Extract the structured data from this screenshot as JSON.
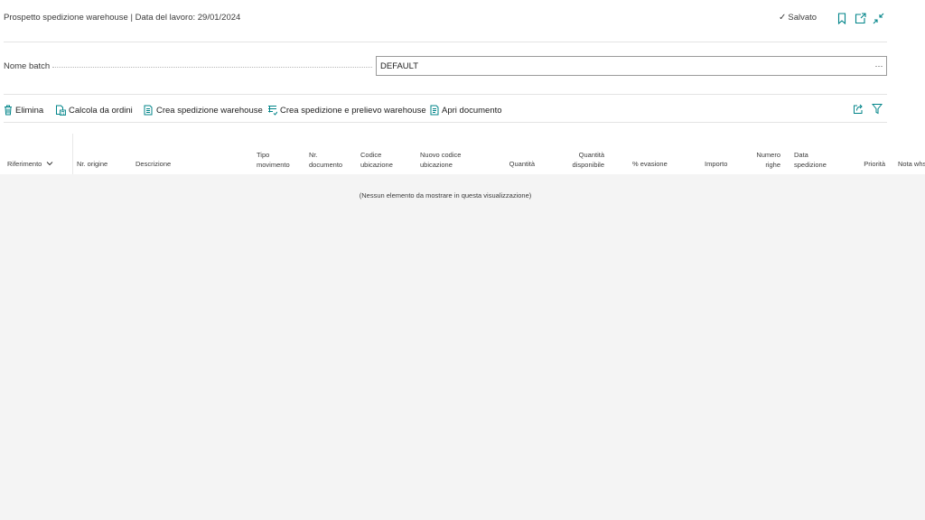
{
  "header": {
    "title": "Prospetto spedizione warehouse | Data del lavoro: 29/01/2024",
    "saved_label": "Salvato"
  },
  "batch": {
    "label": "Nome batch",
    "value": "DEFAULT",
    "more_label": "···"
  },
  "actions": {
    "delete": "Elimina",
    "calculate": "Calcola da ordini",
    "create_shipment": "Crea spedizione warehouse",
    "create_shipment_pick": "Crea spedizione e prelievo warehouse",
    "open_document": "Apri documento"
  },
  "columns": {
    "reference": "Riferimento",
    "origin_no": "Nr. origine",
    "description": "Descrizione",
    "movement_type_1": "Tipo",
    "movement_type_2": "movimento",
    "document_no_1": "Nr.",
    "document_no_2": "documento",
    "bin_code_1": "Codice",
    "bin_code_2": "ubicazione",
    "new_bin_code_1": "Nuovo codice",
    "new_bin_code_2": "ubicazione",
    "quantity": "Quantità",
    "available_qty_1": "Quantità",
    "available_qty_2": "disponibile",
    "fulfillment": "% evasione",
    "amount": "Importo",
    "line_count_1": "Numero",
    "line_count_2": "righe",
    "shipment_date_1": "Data",
    "shipment_date_2": "spedizione",
    "priority": "Priorità",
    "note": "Nota whs"
  },
  "grid": {
    "empty_message": "(Nessun elemento da mostrare in questa visualizzazione)"
  },
  "colors": {
    "accent": "#008489",
    "grid_background": "#f4f4f4",
    "border": "#9a9a9a"
  }
}
